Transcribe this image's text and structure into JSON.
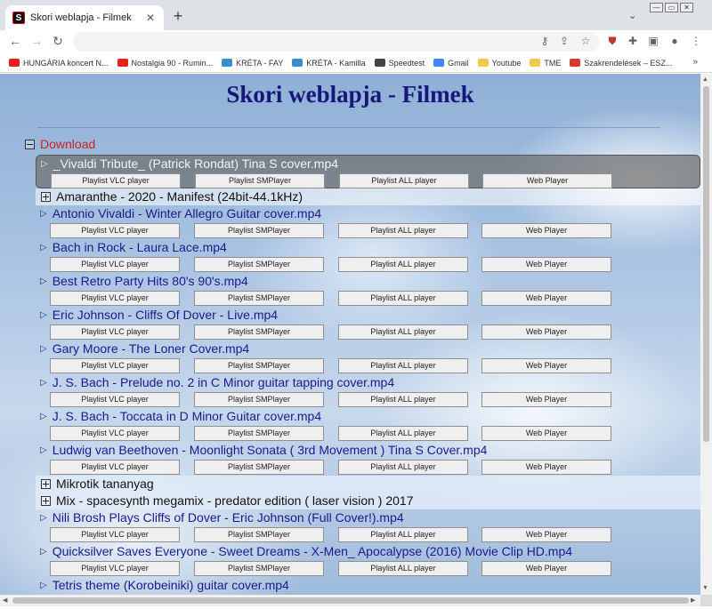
{
  "browser": {
    "tab_title": "Skori weblapja - Filmek",
    "favicon_letter": "S",
    "new_tab_icon": "+",
    "bookmarks": [
      {
        "label": "HUNGÁRIA koncert N...",
        "icon": "youtube-icon",
        "color": "#e62117"
      },
      {
        "label": "Nostalgia 90 - Rumin...",
        "icon": "youtube-icon",
        "color": "#e62117"
      },
      {
        "label": "KRÉTA - FAY",
        "icon": "kreta-icon",
        "color": "#3a8ed0"
      },
      {
        "label": "KRÉTA - Kamilla",
        "icon": "kreta-icon",
        "color": "#3a8ed0"
      },
      {
        "label": "Speedtest",
        "icon": "speedtest-icon",
        "color": "#444444"
      },
      {
        "label": "Gmail",
        "icon": "google-icon",
        "color": "#4285f4"
      },
      {
        "label": "Youtube",
        "icon": "folder-icon",
        "color": "#f2c94c"
      },
      {
        "label": "TME",
        "icon": "folder-icon",
        "color": "#f2c94c"
      },
      {
        "label": "Szakrendelések – ESZ...",
        "icon": "medical-cross-icon",
        "color": "#d33b2c"
      }
    ],
    "bookmarks_more": "»"
  },
  "page": {
    "title": "Skori weblapja - Filmek",
    "download_label": "Download",
    "buttons": {
      "vlc": "Playlist VLC player",
      "smplayer": "Playlist SMPlayer",
      "all": "Playlist ALL player",
      "web": "Web Player"
    },
    "entries": [
      {
        "type": "file",
        "title": "_Vivaldi Tribute_ (Patrick Rondat) Tina S cover.mp4",
        "active": true
      },
      {
        "type": "folder",
        "title": "Amaranthe - 2020 - Manifest (24bit-44.1kHz)"
      },
      {
        "type": "file",
        "title": "Antonio Vivaldi - Winter Allegro Guitar cover.mp4"
      },
      {
        "type": "file",
        "title": "Bach in Rock - Laura Lace.mp4"
      },
      {
        "type": "file",
        "title": "Best Retro Party Hits 80's 90's.mp4"
      },
      {
        "type": "file",
        "title": "Eric Johnson - Cliffs Of Dover - Live.mp4"
      },
      {
        "type": "file",
        "title": "Gary Moore - The Loner Cover.mp4"
      },
      {
        "type": "file",
        "title": "J. S. Bach - Prelude no. 2 in C Minor guitar tapping cover.mp4"
      },
      {
        "type": "file",
        "title": "J. S. Bach - Toccata in D Minor Guitar cover.mp4"
      },
      {
        "type": "file",
        "title": "Ludwig van Beethoven - Moonlight Sonata ( 3rd Movement ) Tina S Cover.mp4"
      },
      {
        "type": "folder",
        "title": "Mikrotik tananyag",
        "highlight": true
      },
      {
        "type": "folder",
        "title": "Mix - spacesynth megamix - predator edition ( laser vision ) 2017",
        "highlight": true
      },
      {
        "type": "file",
        "title": "Nili Brosh Plays Cliffs of Dover - Eric Johnson (Full Cover!).mp4"
      },
      {
        "type": "file",
        "title": "Quicksilver Saves Everyone - Sweet Dreams - X-Men_ Apocalypse (2016) Movie Clip HD.mp4"
      },
      {
        "type": "file",
        "title": "Tetris theme (Korobeiniki) guitar cover.mp4"
      }
    ]
  }
}
